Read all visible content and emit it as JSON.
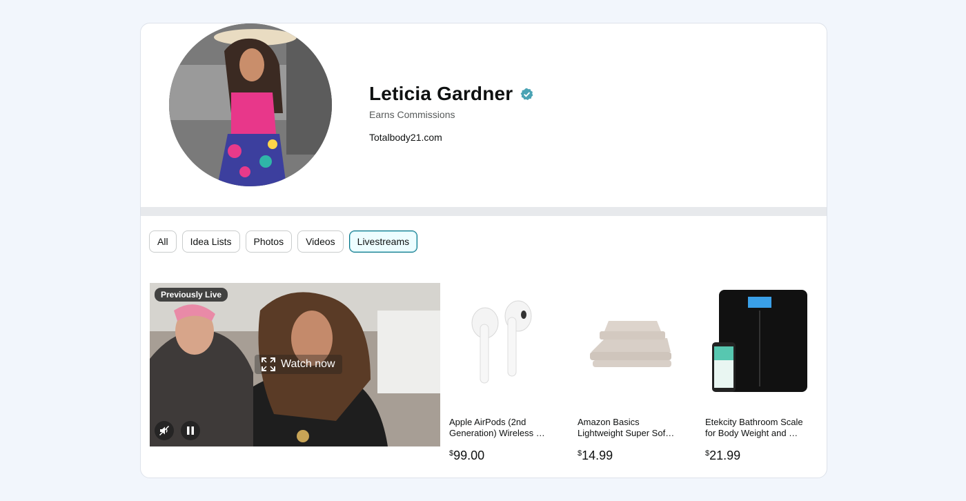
{
  "profile": {
    "name": "Leticia Gardner",
    "role": "Earns Commissions",
    "website": "Totalbody21.com"
  },
  "tabs": [
    {
      "label": "All",
      "active": false
    },
    {
      "label": "Idea Lists",
      "active": false
    },
    {
      "label": "Photos",
      "active": false
    },
    {
      "label": "Videos",
      "active": false
    },
    {
      "label": "Livestreams",
      "active": true
    }
  ],
  "video": {
    "badge": "Previously Live",
    "watch_label": "Watch now",
    "mute_icon": "muted-speaker-icon",
    "pause_icon": "pause-icon"
  },
  "products": [
    {
      "title_line1": "Apple AirPods (2nd",
      "title_line2": "Generation) Wireless Ear Buds",
      "price_symbol": "$",
      "price_value": "99.00"
    },
    {
      "title_line1": "Amazon Basics",
      "title_line2": "Lightweight Super Soft Easy Care",
      "price_symbol": "$",
      "price_value": "14.99"
    },
    {
      "title_line1": "Etekcity Bathroom Scale",
      "title_line2": "for Body Weight and BMI Digital",
      "price_symbol": "$",
      "price_value": "21.99"
    }
  ],
  "colors": {
    "accent": "#007185",
    "verified": "#4aa3b4",
    "active_tab_bg": "#edfdff"
  }
}
